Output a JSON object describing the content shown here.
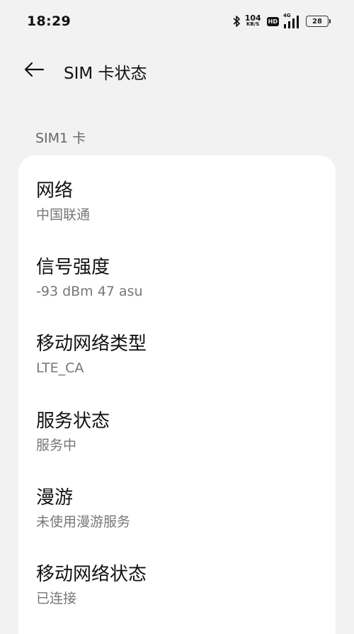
{
  "status_bar": {
    "time": "18:29",
    "net_speed_value": "104",
    "net_speed_unit": "KB/S",
    "hd_label": "HD",
    "network_type": "4G",
    "battery": "28"
  },
  "app_bar": {
    "title": "SIM 卡状态"
  },
  "section": {
    "header": "SIM1 卡"
  },
  "items": [
    {
      "title": "网络",
      "value": "中国联通"
    },
    {
      "title": "信号强度",
      "value": "-93 dBm 47 asu"
    },
    {
      "title": "移动网络类型",
      "value": "LTE_CA"
    },
    {
      "title": "服务状态",
      "value": "服务中"
    },
    {
      "title": "漫游",
      "value": "未使用漫游服务"
    },
    {
      "title": "移动网络状态",
      "value": "已连接"
    }
  ]
}
